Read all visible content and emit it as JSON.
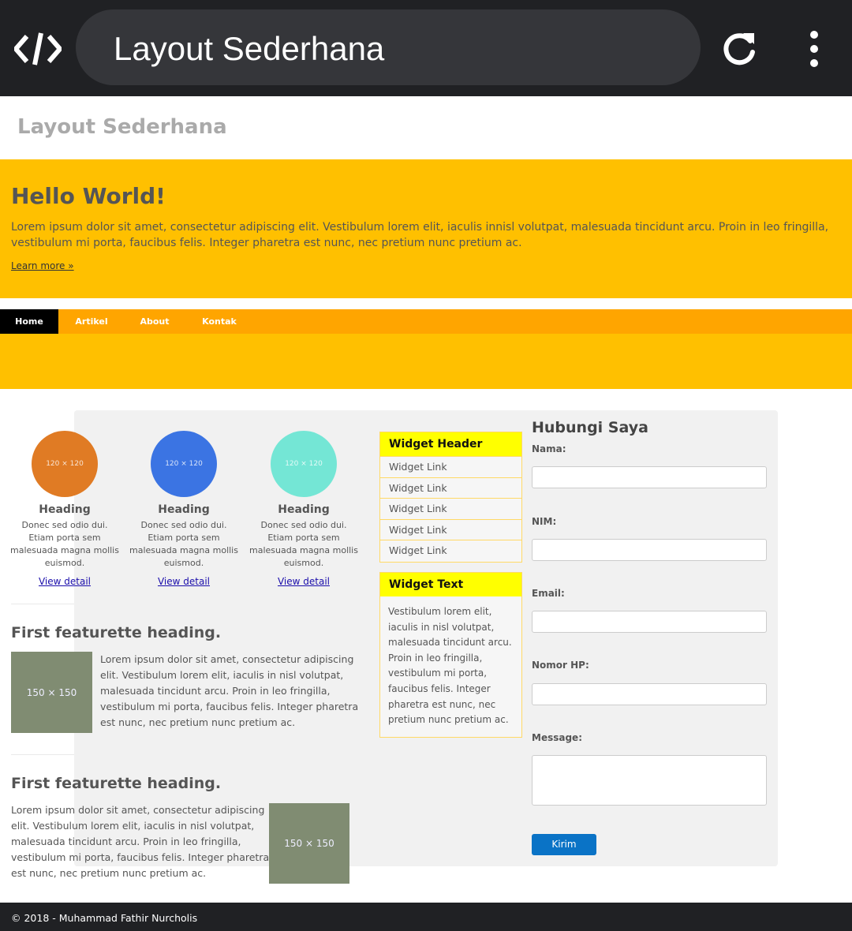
{
  "browser": {
    "url_title": "Layout Sederhana",
    "icons": [
      "code-app-icon",
      "reload-icon",
      "more-vert-icon"
    ]
  },
  "site": {
    "title": "Layout Sederhana"
  },
  "hero": {
    "heading": "Hello World!",
    "text": "Lorem ipsum dolor sit amet, consectetur adipiscing elit. Vestibulum lorem elit, iaculis innisl volutpat, malesuada tincidunt arcu. Proin in leo fringilla, vestibulum mi porta, faucibus felis. Integer pharetra est nunc, nec pretium nunc pretium ac.",
    "link": "Learn more »",
    "color": "#ffc000"
  },
  "nav": {
    "items": [
      {
        "label": "Home"
      },
      {
        "label": "Artikel"
      },
      {
        "label": "About"
      },
      {
        "label": "Kontak"
      }
    ],
    "active": "Home",
    "color": "#ffa500"
  },
  "columns": [
    {
      "image_label": "120 × 120",
      "color": "#e07b24",
      "heading": "Heading",
      "text": "Donec sed odio dui. Etiam porta sem malesuada magna mollis euismod.",
      "link": "View detail"
    },
    {
      "image_label": "120 × 120",
      "color": "#3b74e3",
      "heading": "Heading",
      "text": "Donec sed odio dui. Etiam porta sem malesuada magna mollis euismod.",
      "link": "View detail"
    },
    {
      "image_label": "120 × 120",
      "color": "#74e6d5",
      "heading": "Heading",
      "text": "Donec sed odio dui. Etiam porta sem malesuada magna mollis euismod.",
      "link": "View detail"
    }
  ],
  "featurettes": [
    {
      "heading": "First featurette heading.",
      "image_label": "150 × 150",
      "text": "Lorem ipsum dolor sit amet, consectetur adipiscing elit. Vestibulum lorem elit, iaculis in nisl volutpat, malesuada tincidunt arcu. Proin in leo fringilla, vestibulum mi porta, faucibus felis. Integer pharetra est nunc, nec pretium nunc pretium ac."
    },
    {
      "heading": "First featurette heading.",
      "image_label": "150 × 150",
      "text": "Lorem ipsum dolor sit amet, consectetur adipiscing elit. Vestibulum lorem elit, iaculis in nisl volutpat, malesuada tincidunt arcu. Proin in leo fringilla, vestibulum mi porta, faucibus felis. Integer pharetra est nunc, nec pretium nunc pretium ac."
    }
  ],
  "widgets": {
    "header": {
      "title": "Widget Header",
      "links": [
        "Widget Link",
        "Widget Link",
        "Widget Link",
        "Widget Link",
        "Widget Link"
      ]
    },
    "text": {
      "title": "Widget Text",
      "body": "Vestibulum lorem elit, iaculis in nisl volutpat, malesuada tincidunt arcu. Proin in leo fringilla, vestibulum mi porta, faucibus felis. Integer pharetra est nunc, nec pretium nunc pretium ac."
    },
    "accent": "#ffff00"
  },
  "form": {
    "title": "Hubungi Saya",
    "labels": {
      "nama": "Nama:",
      "nim": "NIM:",
      "email": "Email:",
      "hp": "Nomor HP:",
      "message": "Message:"
    },
    "values": {
      "nama": "",
      "nim": "",
      "email": "",
      "hp": "",
      "message": ""
    },
    "submit": "Kirim",
    "button_color": "#0a73c6"
  },
  "footer": {
    "text": "© 2018 - Muhammad Fathir Nurcholis"
  }
}
